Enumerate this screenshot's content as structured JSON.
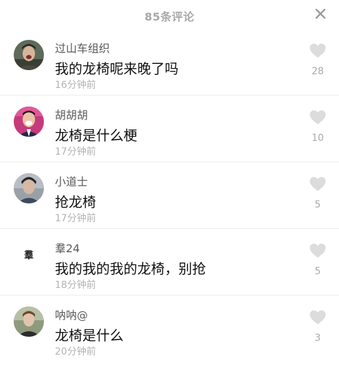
{
  "header": {
    "title": "85条评论"
  },
  "comments": [
    {
      "username": "过山车组织",
      "text": "我的龙椅呢来晚了吗",
      "time": "16分钟前",
      "likes": "28"
    },
    {
      "username": "胡胡胡",
      "text": "龙椅是什么梗",
      "time": "17分钟前",
      "likes": "10"
    },
    {
      "username": "小道士",
      "text": "抢龙椅",
      "time": "17分钟前",
      "likes": "5"
    },
    {
      "username": "羣24",
      "avatar_text": "羣",
      "text": "我的我的我的龙椅，别抢",
      "time": "18分钟前",
      "likes": "5"
    },
    {
      "username": "呐呐@",
      "text": "龙椅是什么",
      "time": "20分钟前",
      "likes": "3"
    }
  ],
  "colors": {
    "like_icon": "#dcdcdc",
    "title": "#a9a9a9",
    "divider": "#ececec"
  }
}
